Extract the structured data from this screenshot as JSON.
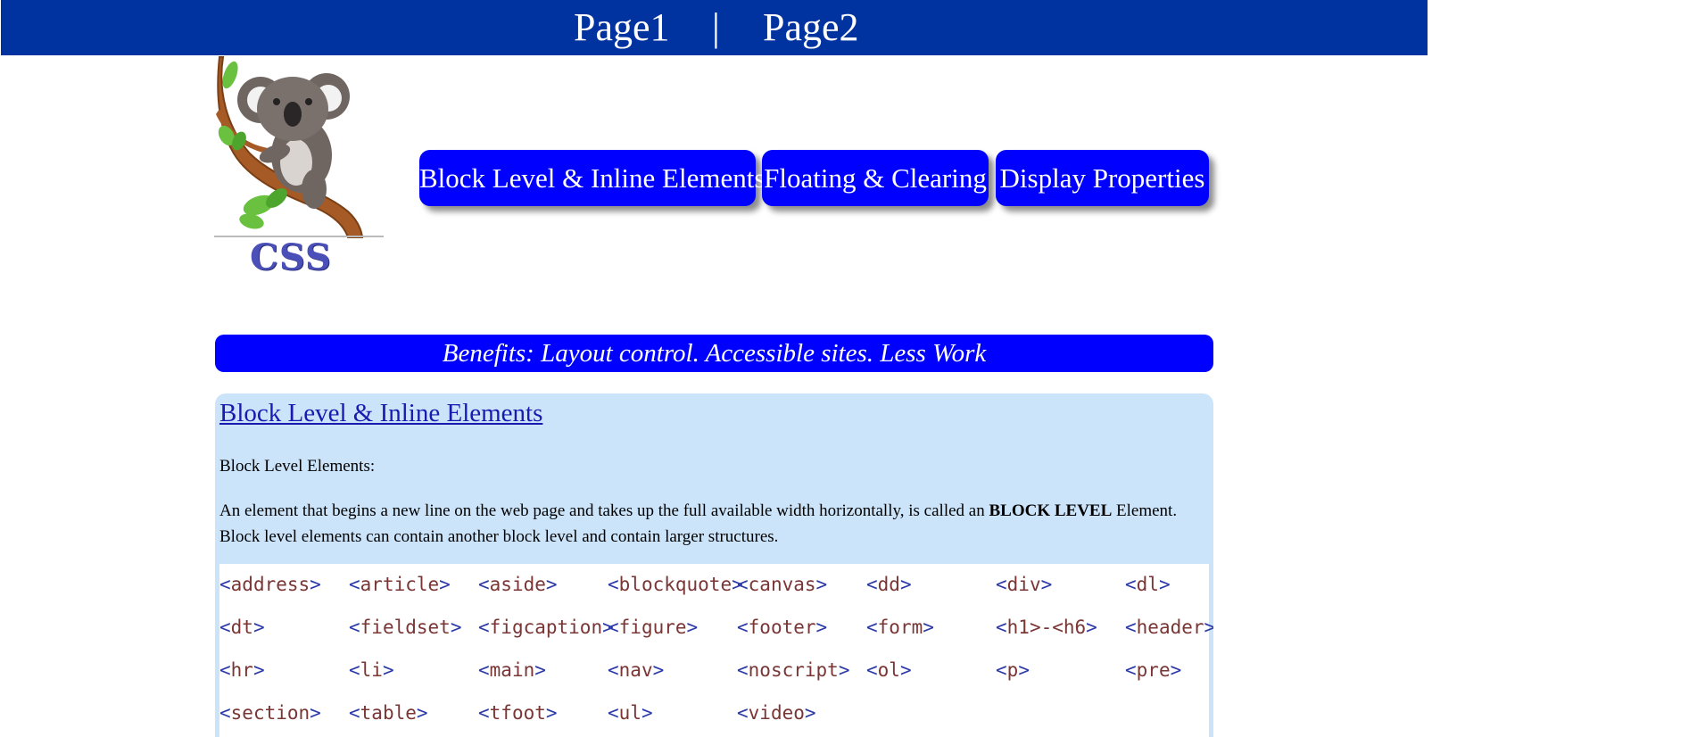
{
  "topnav": {
    "page1": "Page1",
    "separator": "|",
    "page2": "Page2"
  },
  "logo": {
    "caption": "CSS",
    "icon": "koala-on-branch-logo"
  },
  "nav_buttons": [
    {
      "label": "Block Level & Inline Elements"
    },
    {
      "label": "Floating & Clearing"
    },
    {
      "label": "Display Properties"
    }
  ],
  "banner": {
    "text": "Benefits: Layout control. Accessible sites. Less Work"
  },
  "section": {
    "title": "Block Level & Inline Elements",
    "subtitle": "Block Level Elements:",
    "paragraph_before": "An element that begins a new line on the web page and takes up the full available width horizontally, is called an ",
    "paragraph_bold": "BLOCK LEVEL",
    "paragraph_after": " Element. Block level elements can contain another block level and contain larger structures.",
    "tag_rows": [
      [
        "address",
        "article",
        "aside",
        "blockquote",
        "canvas",
        "dd",
        "div",
        "dl"
      ],
      [
        "dt",
        "fieldset",
        "figcaption",
        "figure",
        "footer",
        "form",
        "h1>-<h6",
        "header"
      ],
      [
        "hr",
        "li",
        "main",
        "nav",
        "noscript",
        "ol",
        "p",
        "pre"
      ],
      [
        "section",
        "table",
        "tfoot",
        "ul",
        "video"
      ]
    ]
  },
  "colors": {
    "topbar": "#0033a0",
    "button": "#0000ff",
    "panel": "#cce4fa",
    "tag_name": "#7a3535",
    "tag_bracket": "#2b3aa8"
  }
}
